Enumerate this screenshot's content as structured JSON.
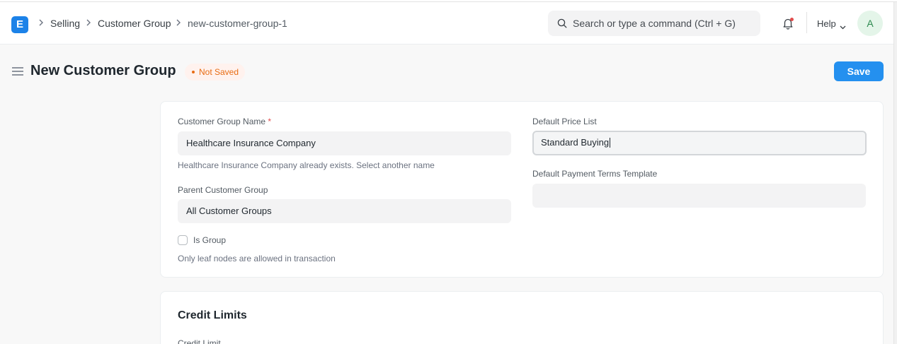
{
  "app": {
    "logo_letter": "E"
  },
  "breadcrumb": {
    "items": [
      "Selling",
      "Customer Group",
      "new-customer-group-1"
    ]
  },
  "search": {
    "placeholder": "Search or type a command (Ctrl + G)"
  },
  "nav": {
    "help_label": "Help",
    "avatar_letter": "A"
  },
  "page": {
    "title": "New Customer Group",
    "status": "Not Saved",
    "save_label": "Save"
  },
  "form": {
    "customer_group_name": {
      "label": "Customer Group Name",
      "required_mark": "*",
      "value": "Healthcare Insurance Company",
      "error": "Healthcare Insurance Company already exists. Select another name"
    },
    "parent_customer_group": {
      "label": "Parent Customer Group",
      "value": "All Customer Groups"
    },
    "is_group": {
      "label": "Is Group",
      "checked": false,
      "help": "Only leaf nodes are allowed in transaction"
    },
    "default_price_list": {
      "label": "Default Price List",
      "value": "Standard Buying"
    },
    "default_payment_terms_template": {
      "label": "Default Payment Terms Template",
      "value": ""
    }
  },
  "credit_limits": {
    "title": "Credit Limits",
    "credit_limit_label": "Credit Limit"
  },
  "colors": {
    "accent": "#2490ef",
    "status_orange": "#e86c13",
    "logo_blue": "#1c82e8"
  }
}
